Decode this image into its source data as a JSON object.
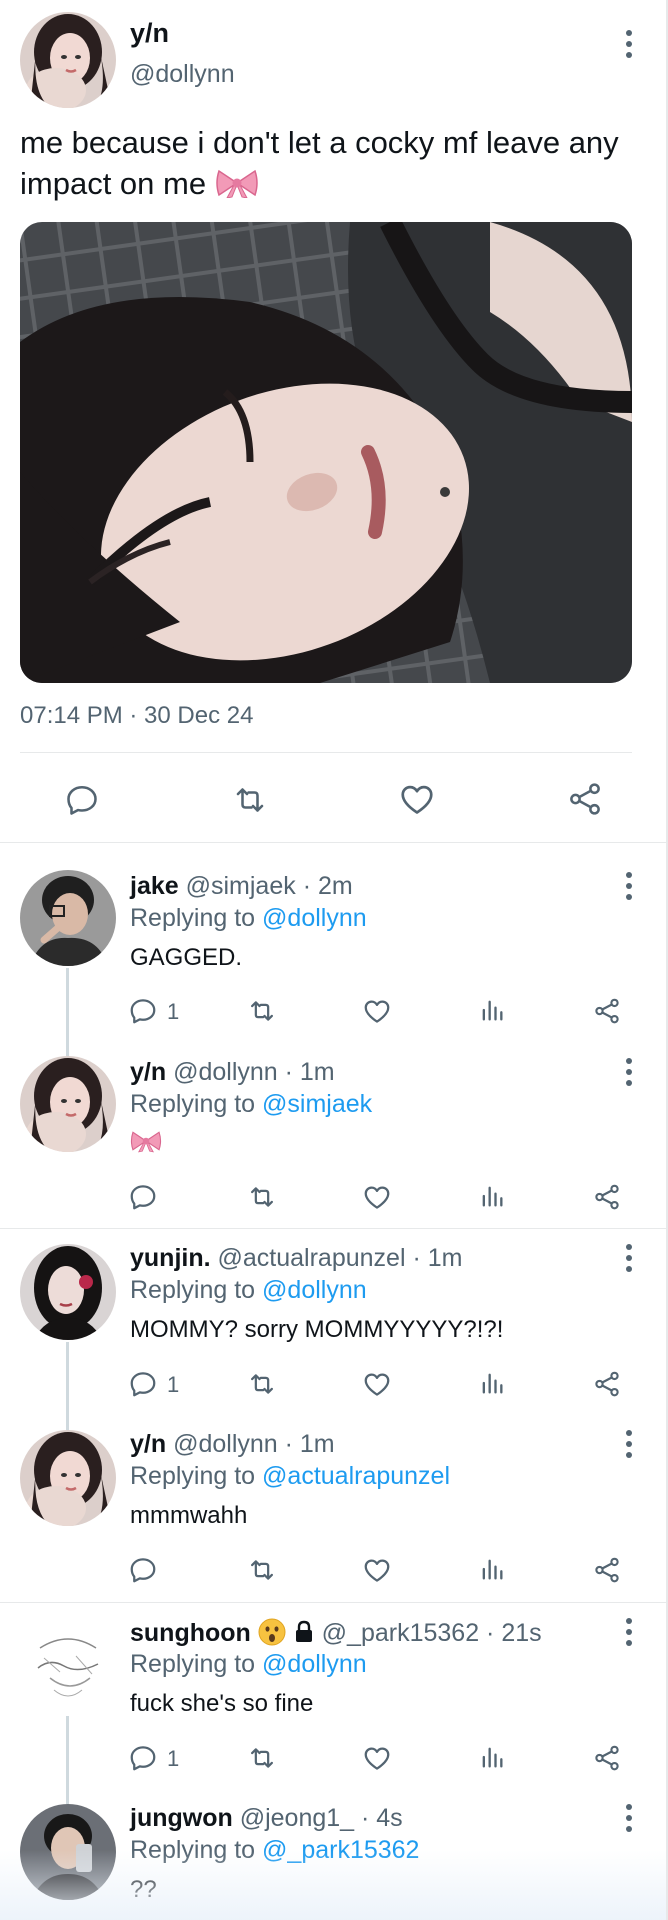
{
  "main_tweet": {
    "name": "y/n",
    "handle": "@dollynn",
    "text": "me because i don't let a cocky mf leave any impact on me",
    "emoji": "bow-emoji",
    "timestamp": "07:14 PM · 30 Dec 24"
  },
  "replies": [
    {
      "name": "jake",
      "handle": "@simjaek",
      "time": " · 2m",
      "replying_prefix": "Replying to ",
      "replying_to": "@dollynn",
      "text": "GAGGED.",
      "reply_count": "1"
    },
    {
      "name": "y/n",
      "handle": "@dollynn",
      "time": " · 1m",
      "replying_prefix": "Replying to ",
      "replying_to": "@simjaek",
      "text": "",
      "emoji": "bow-emoji",
      "reply_count": ""
    },
    {
      "name": "yunjin.",
      "handle": "@actualrapunzel",
      "time": " · 1m",
      "replying_prefix": "Replying to ",
      "replying_to": "@dollynn",
      "text": "MOMMY? sorry MOMMYYYYY?!?!",
      "reply_count": "1"
    },
    {
      "name": "y/n",
      "handle": "@dollynn",
      "time": " · 1m",
      "replying_prefix": "Replying to ",
      "replying_to": "@actualrapunzel",
      "text": "mmmwahh",
      "reply_count": ""
    },
    {
      "name": "sunghoon",
      "handle": "@_park15362",
      "time": " · 21s",
      "replying_prefix": "Replying to ",
      "replying_to": "@dollynn",
      "text": "fuck she's so fine",
      "reply_count": "1",
      "badges": [
        "astonished-face-emoji",
        "lock-icon"
      ]
    },
    {
      "name": "jungwon",
      "handle": "@jeong1_",
      "time": " · 4s",
      "replying_prefix": "Replying to ",
      "replying_to": "@_park15362",
      "text": "??",
      "reply_count": ""
    }
  ],
  "colors": {
    "link": "#1d9bf0",
    "secondary_text": "#536471",
    "icon": "#536471",
    "divider": "#e7e9ea"
  },
  "icons": [
    "reply-icon",
    "retweet-icon",
    "like-icon",
    "views-icon",
    "share-icon",
    "more-icon"
  ]
}
